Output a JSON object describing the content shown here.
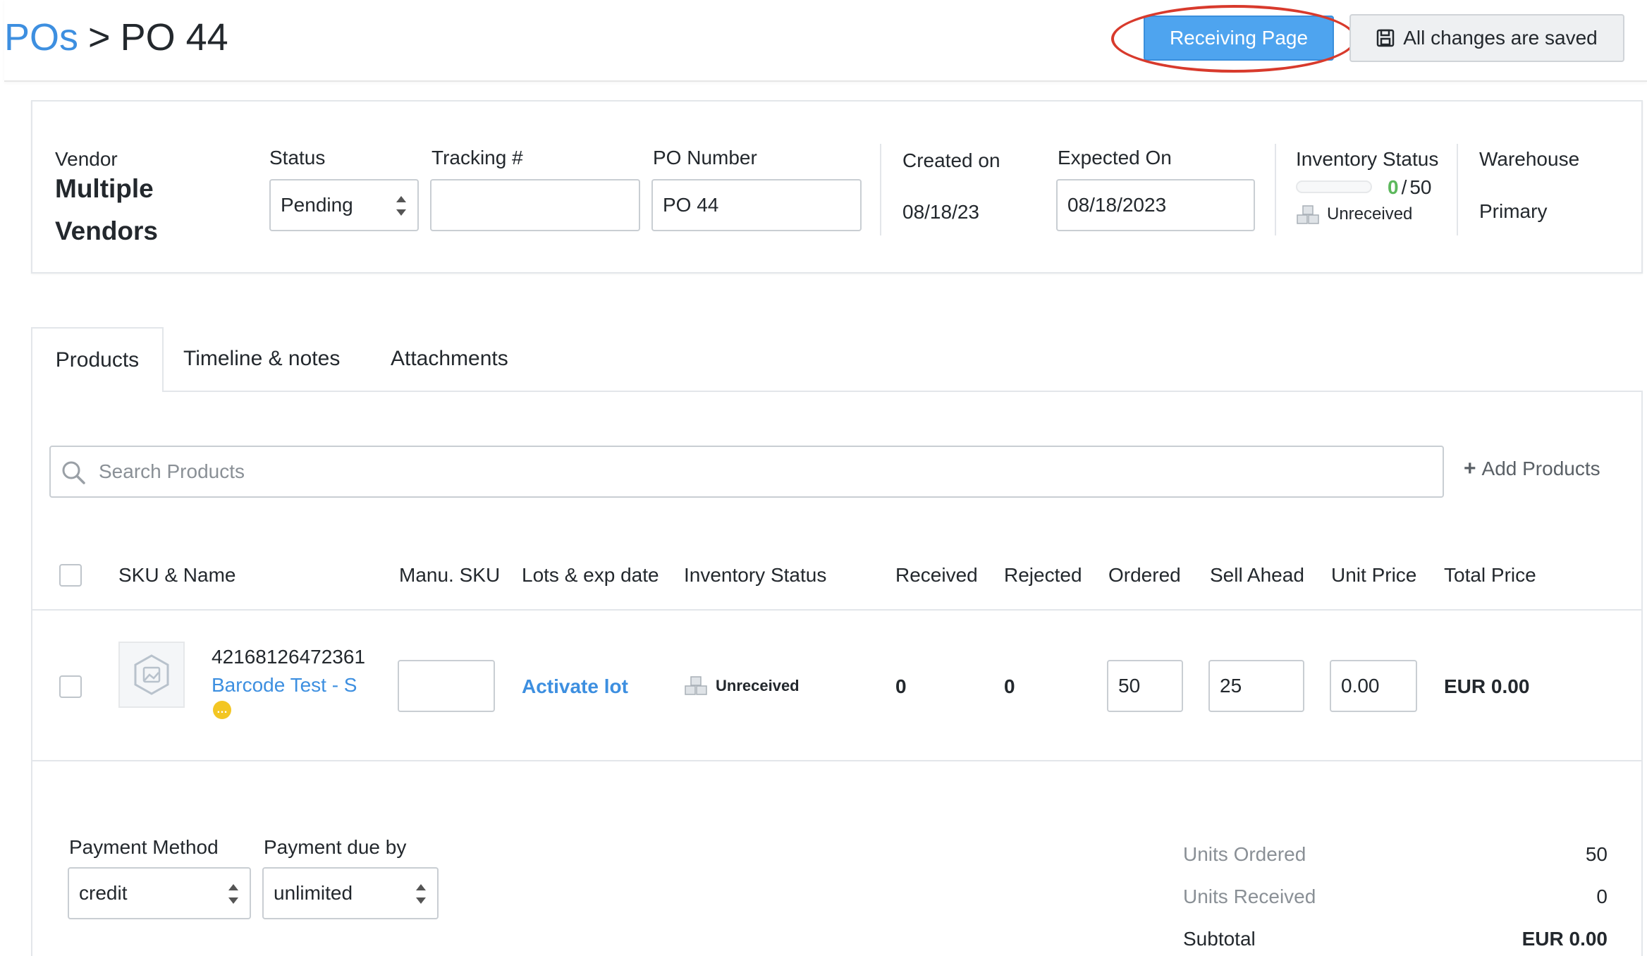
{
  "breadcrumb": {
    "parent": "POs",
    "separator": ">",
    "current": "PO 44"
  },
  "actions": {
    "receiving_page": "Receiving Page",
    "saved_status": "All changes are saved"
  },
  "header": {
    "vendor_label": "Vendor",
    "vendor_line1": "Multiple",
    "vendor_line2": "Vendors",
    "status_label": "Status",
    "status_value": "Pending",
    "tracking_label": "Tracking #",
    "tracking_value": "",
    "po_number_label": "PO Number",
    "po_number_value": "PO 44",
    "created_label": "Created on",
    "created_value": "08/18/23",
    "expected_label": "Expected On",
    "expected_value": "08/18/2023",
    "inventory_label": "Inventory Status",
    "inventory_received": "0",
    "inventory_sep": "/",
    "inventory_total": "50",
    "inventory_progress": 0,
    "inventory_state": "Unreceived",
    "warehouse_label": "Warehouse",
    "warehouse_value": "Primary"
  },
  "tabs": [
    "Products",
    "Timeline & notes",
    "Attachments"
  ],
  "search": {
    "placeholder": "Search Products",
    "add_label": "Add Products"
  },
  "table": {
    "columns": [
      "SKU & Name",
      "Manu. SKU",
      "Lots & exp date",
      "Inventory Status",
      "Received",
      "Rejected",
      "Ordered",
      "Sell Ahead",
      "Unit Price",
      "Total Price"
    ],
    "rows": [
      {
        "sku": "42168126472361",
        "name": "Barcode Test - S",
        "manu_sku": "",
        "lots": "Activate lot",
        "inventory_status": "Unreceived",
        "received": "0",
        "rejected": "0",
        "ordered": "50",
        "sell_ahead": "25",
        "unit_price": "0.00",
        "total_price": "EUR 0.00"
      }
    ]
  },
  "footer": {
    "payment_method_label": "Payment Method",
    "payment_method_value": "credit",
    "payment_due_label": "Payment due by",
    "payment_due_value": "unlimited",
    "units_ordered_label": "Units Ordered",
    "units_ordered_value": "50",
    "units_received_label": "Units Received",
    "units_received_value": "0",
    "subtotal_label": "Subtotal",
    "subtotal_value": "EUR 0.00"
  },
  "colors": {
    "accent": "#3d8fe0",
    "primary_button": "#4ea4ef",
    "highlight_ring": "#d83a2c",
    "success": "#5cb85c"
  }
}
